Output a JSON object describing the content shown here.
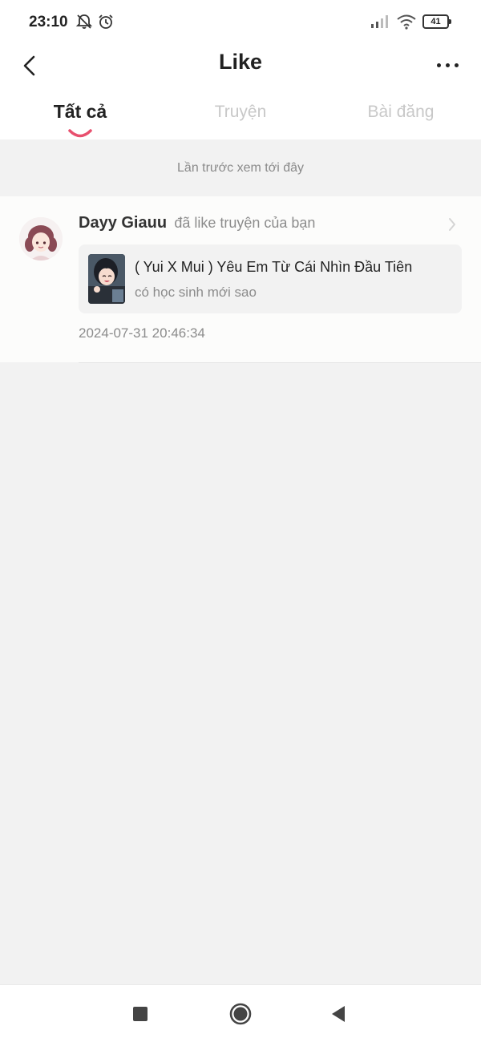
{
  "status_bar": {
    "time": "23:10",
    "battery": "41",
    "icons": [
      "bell-off-icon",
      "alarm-icon",
      "signal-icon",
      "wifi-icon",
      "battery-icon"
    ]
  },
  "header": {
    "title": "Like",
    "back_icon": "chevron-left-icon",
    "more_icon": "more-horizontal-icon"
  },
  "tabs": [
    {
      "label": "Tất cả",
      "active": true
    },
    {
      "label": "Truyện",
      "active": false
    },
    {
      "label": "Bài đăng",
      "active": false
    }
  ],
  "notice": {
    "text": "Lần trước xem tới đây"
  },
  "notifications": [
    {
      "user": "Dayy Giauu",
      "action": "đã like truyện của bạn",
      "story": {
        "title": "( Yui X Mui ) Yêu Em Từ Cái Nhìn Đầu Tiên",
        "subtitle": "có học sinh mới sao"
      },
      "timestamp": "2024-07-31 20:46:34"
    }
  ],
  "nav_bar": {
    "icons": [
      "recent-apps-icon",
      "home-icon",
      "back-icon"
    ]
  },
  "colors": {
    "accent": "#e8506e",
    "text_primary": "#222222",
    "text_secondary": "#8c8c8c",
    "tab_inactive": "#c8c8c8",
    "background": "#f2f2f2"
  }
}
